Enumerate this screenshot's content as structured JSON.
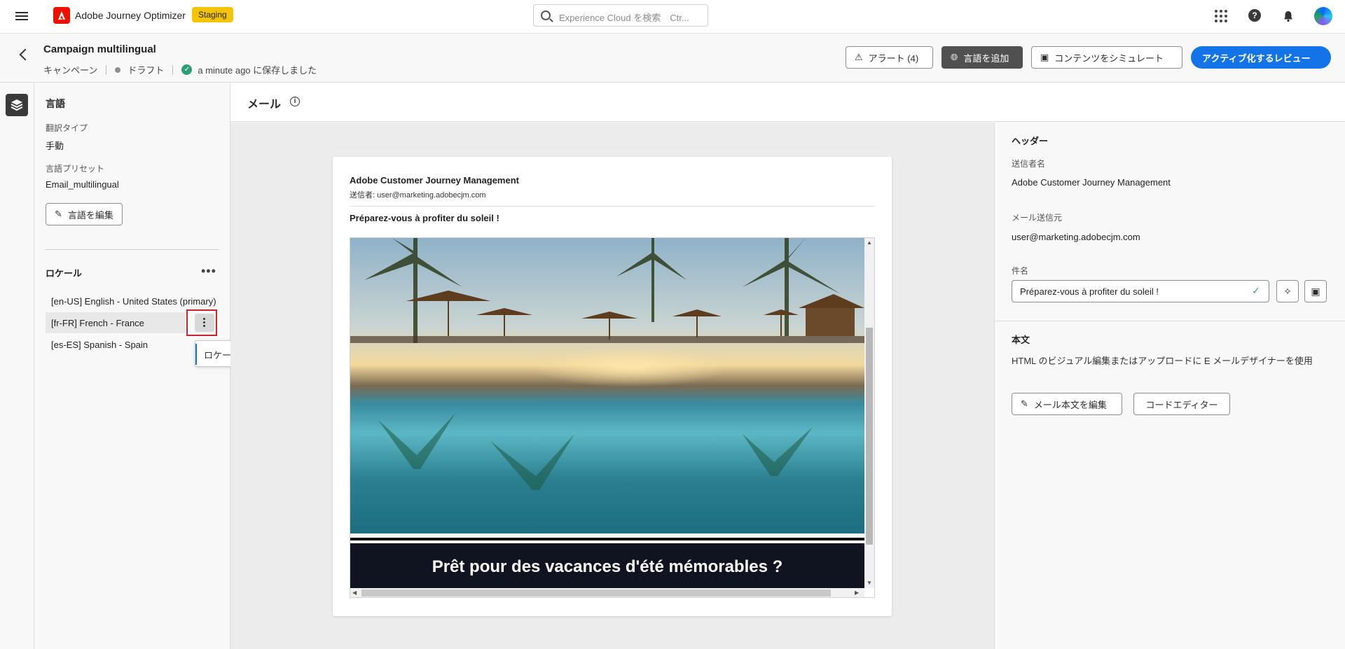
{
  "app": {
    "name": "Adobe Journey Optimizer",
    "env_badge": "Staging",
    "search_placeholder": "Experience Cloud を検索　Ctr..."
  },
  "campaign": {
    "title": "Campaign multilingual",
    "type": "キャンペーン",
    "status": "ドラフト",
    "saved": "a minute ago に保存しました"
  },
  "actions": {
    "alerts": "アラート (4)",
    "add_language": "言語を追加",
    "simulate": "コンテンツをシミュレート",
    "review": "アクティブ化するレビュー"
  },
  "left": {
    "heading": "言語",
    "translation_type_label": "翻訳タイプ",
    "translation_type_value": "手動",
    "preset_label": "言語プリセット",
    "preset_value": "Email_multilingual",
    "edit_button": "言語を編集",
    "locale_heading": "ロケール",
    "more": "•••",
    "locales": [
      {
        "label": "[en-US] English - United States (primary)"
      },
      {
        "label": "[fr-FR] French - France"
      },
      {
        "label": "[es-ES] Spanish - Spain"
      }
    ],
    "popover": "ロケールを無効にする"
  },
  "center": {
    "title": "メール",
    "from_name": "Adobe Customer Journey Management",
    "from_addr": "送信者:  user@marketing.adobecjm.com",
    "subject": "Préparez-vous à profiter du soleil !",
    "banner": "Prêt pour des vacances d'été mémorables ?"
  },
  "right": {
    "header_heading": "ヘッダー",
    "sender_name_label": "送信者名",
    "sender_name_value": "Adobe Customer Journey Management",
    "from_label": "メール送信元",
    "from_value": "user@marketing.adobecjm.com",
    "subject_label": "件名",
    "subject_value": "Préparez-vous à profiter du soleil !",
    "body_heading": "本文",
    "body_desc": "HTML のビジュアル編集またはアップロードに E メールデザイナーを使用",
    "edit_body": "メール本文を編集",
    "code_editor": "コードエディター"
  }
}
